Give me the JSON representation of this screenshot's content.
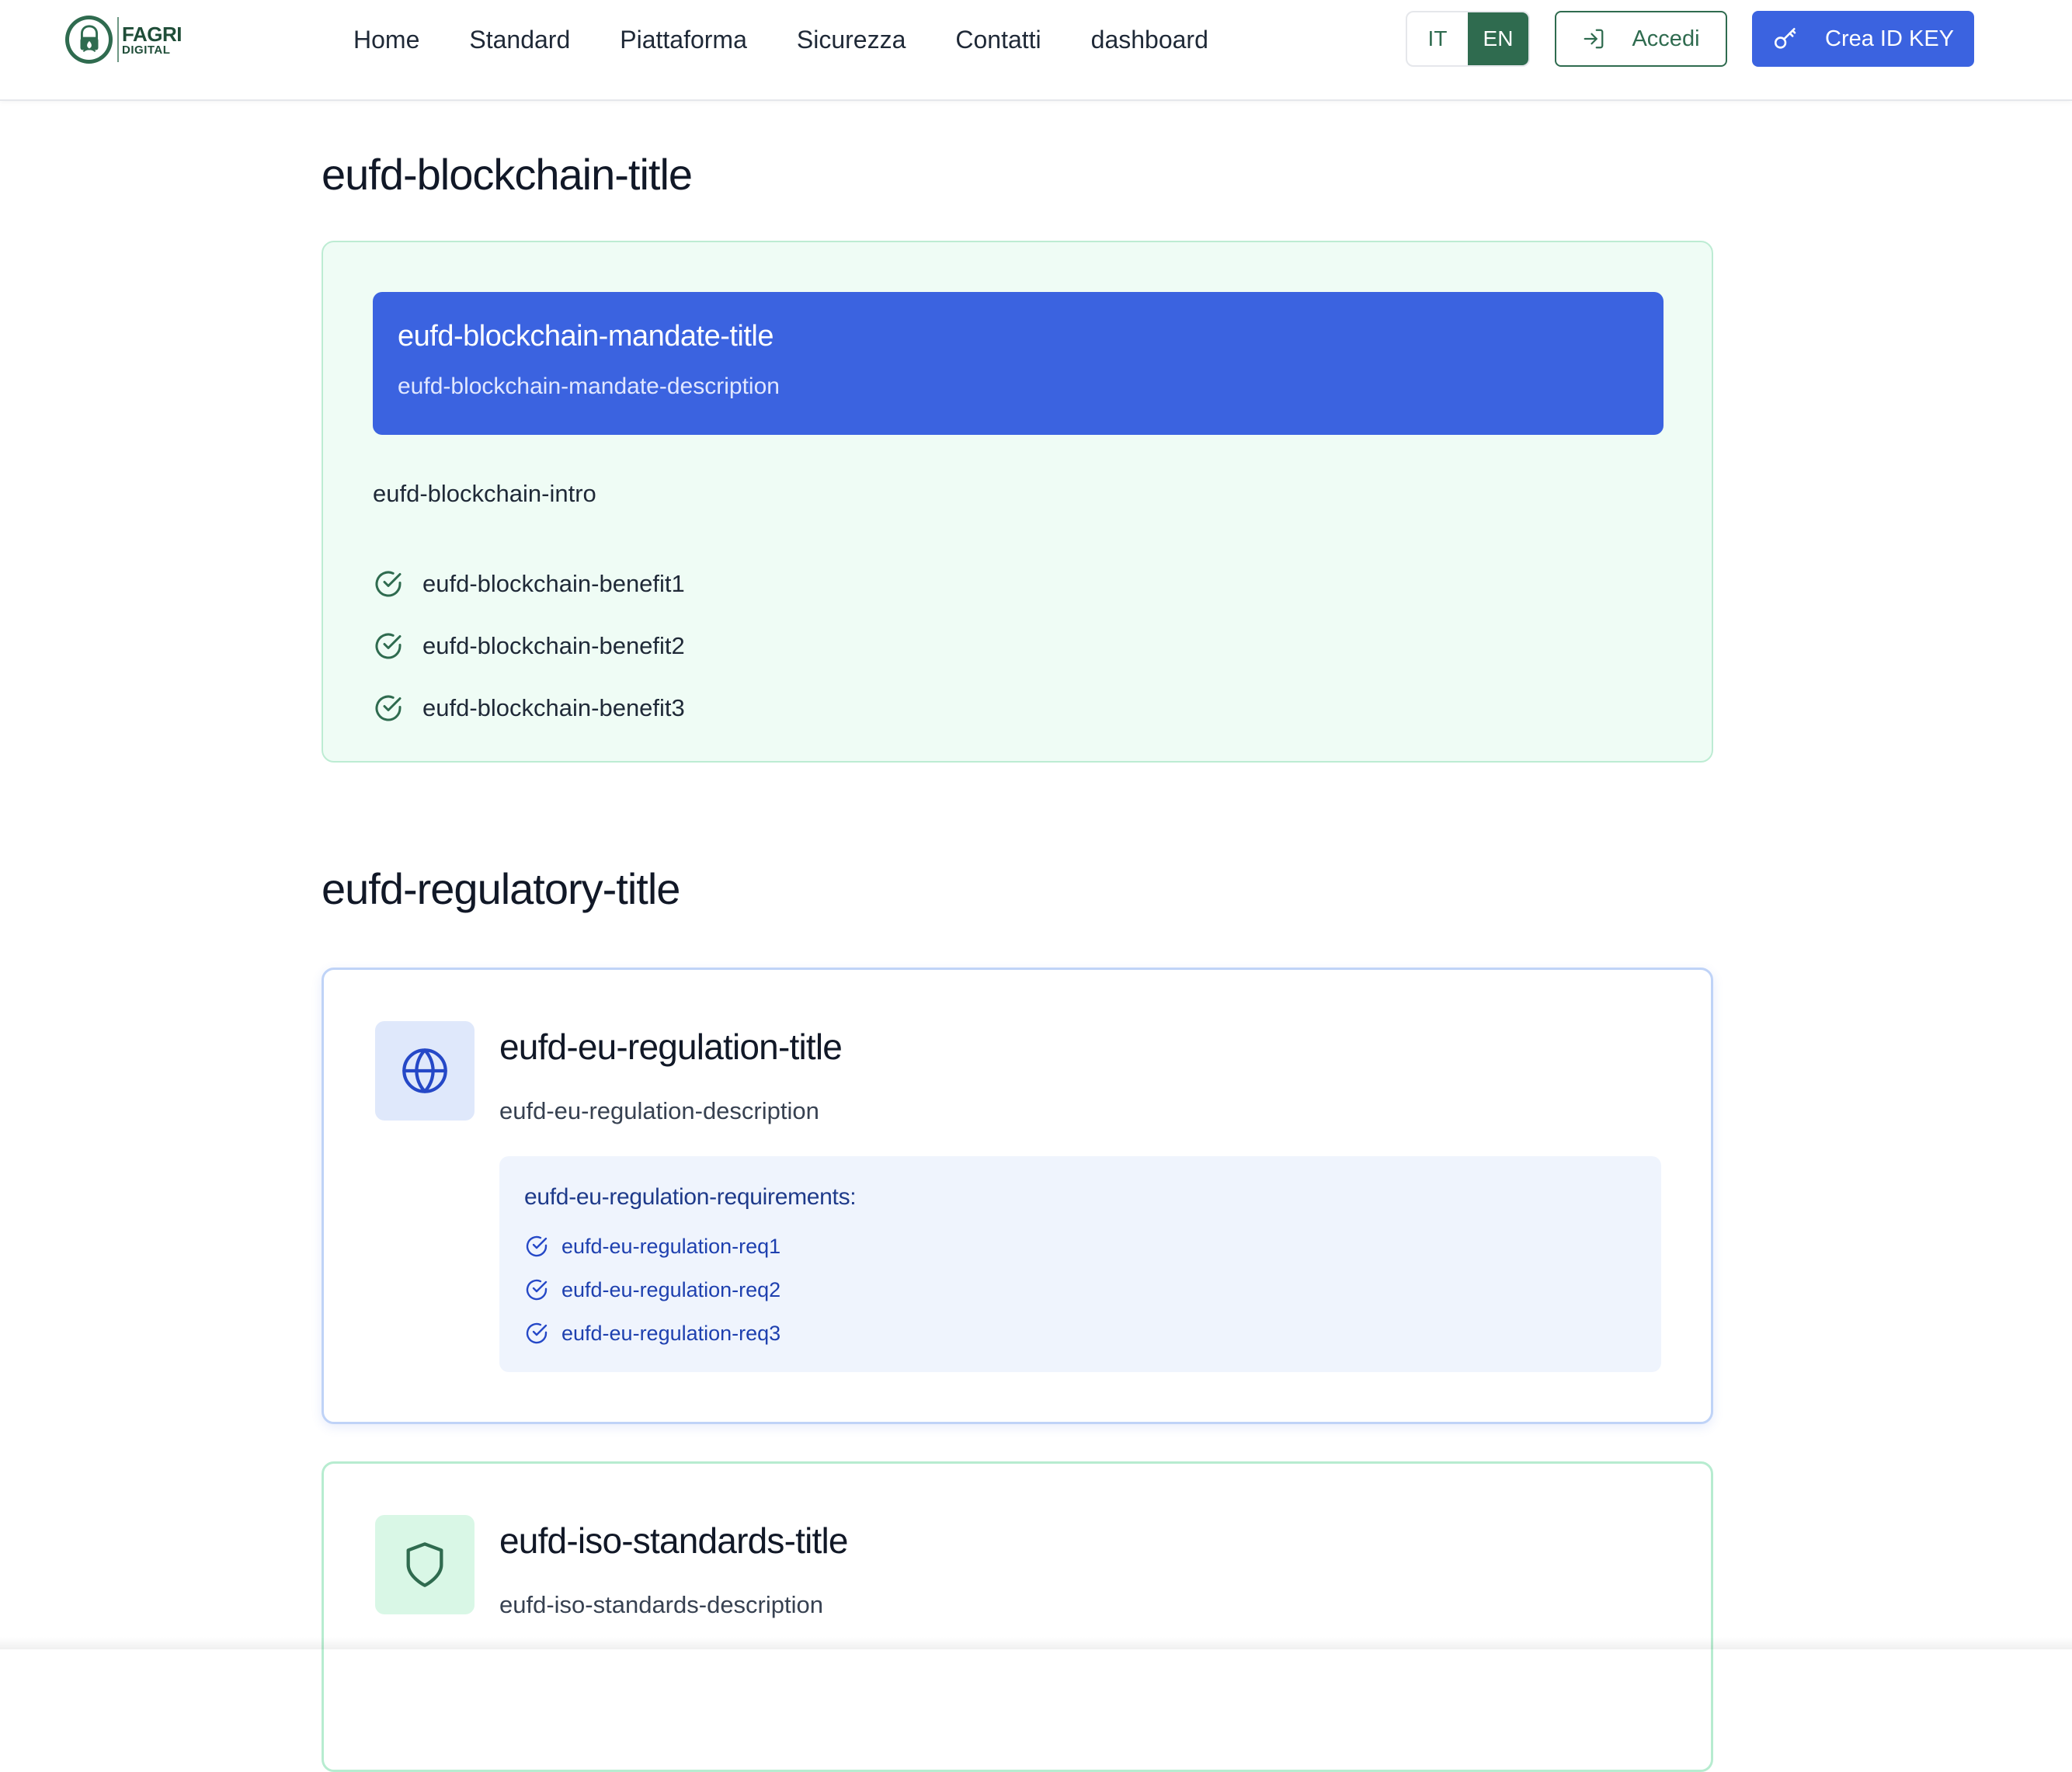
{
  "brand": {
    "logo_line1": "FAGRI",
    "logo_line2": "DIGITAL"
  },
  "nav": {
    "items": [
      "Home",
      "Standard",
      "Piattaforma",
      "Sicurezza",
      "Contatti",
      "dashboard"
    ]
  },
  "language": {
    "options": [
      "IT",
      "EN"
    ],
    "selected": "EN"
  },
  "header_actions": {
    "login_label": "Accedi",
    "login_icon": "login-icon",
    "create_label": "Crea ID KEY",
    "create_icon": "key-icon"
  },
  "blockchain": {
    "title": "eufd-blockchain-title",
    "mandate_title": "eufd-blockchain-mandate-title",
    "mandate_description": "eufd-blockchain-mandate-description",
    "intro": "eufd-blockchain-intro",
    "benefits": [
      "eufd-blockchain-benefit1",
      "eufd-blockchain-benefit2",
      "eufd-blockchain-benefit3"
    ],
    "benefit_icon": "check-circle-icon"
  },
  "regulatory": {
    "title": "eufd-regulatory-title",
    "eu_regulation": {
      "icon": "globe-icon",
      "title": "eufd-eu-regulation-title",
      "description": "eufd-eu-regulation-description",
      "requirements_title": "eufd-eu-regulation-requirements:",
      "requirements": [
        "eufd-eu-regulation-req1",
        "eufd-eu-regulation-req2",
        "eufd-eu-regulation-req3"
      ]
    },
    "iso_standards": {
      "icon": "shield-icon",
      "title": "eufd-iso-standards-title",
      "description": "eufd-iso-standards-description"
    }
  },
  "colors": {
    "brand_green": "#2f6b4f",
    "primary_blue": "#3b63e0",
    "green_card_bg": "#effcf5",
    "req_box_bg": "#eff4fd"
  }
}
